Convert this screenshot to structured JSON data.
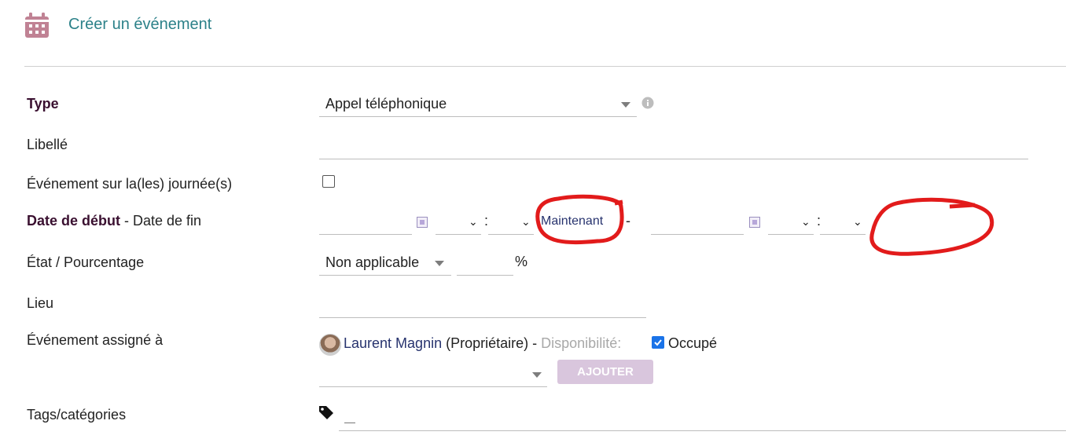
{
  "header": {
    "title": "Créer un événement",
    "icon": "calendar-icon"
  },
  "form": {
    "type": {
      "label": "Type",
      "value": "Appel téléphonique",
      "info_icon": "info-icon"
    },
    "libelle": {
      "label": "Libellé",
      "value": ""
    },
    "journee": {
      "label": "Événement sur la(les) journée(s)",
      "checked": false
    },
    "dates": {
      "label_bold": "Date de début",
      "separator": " - ",
      "label_rest": "Date de fin",
      "maintenant": "Maintenant",
      "dash": "-",
      "colon": ":"
    },
    "etat": {
      "label": "État / Pourcentage",
      "value": "Non applicable",
      "percent_symbol": "%"
    },
    "lieu": {
      "label": "Lieu",
      "value": ""
    },
    "assigned": {
      "label": "Événement assigné à",
      "user_name": "Laurent Magnin",
      "user_role": "(Propriétaire) -",
      "dispo_label": "Disponibilité:",
      "occupe_label": "Occupé",
      "occupe_checked": true,
      "add_button": "AJOUTER"
    },
    "tags": {
      "label": "Tags/catégories",
      "icon": "tag-icon"
    }
  },
  "colors": {
    "accent_title": "#2c8189",
    "label_bold": "#3a1030",
    "button_disabled": "#d9c6dd",
    "annotation_red": "#e21b1b"
  }
}
